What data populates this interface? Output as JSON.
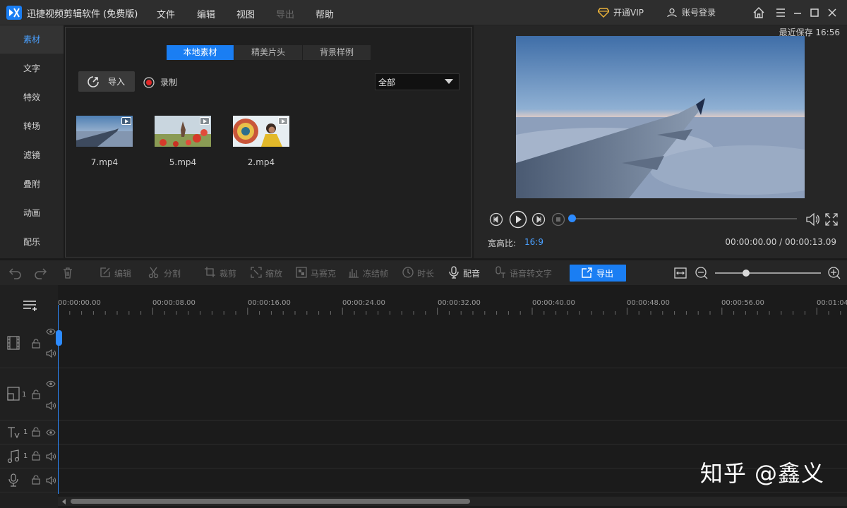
{
  "window": {
    "title": "迅捷视频剪辑软件 (免费版)",
    "menu": [
      "文件",
      "编辑",
      "视图",
      "导出",
      "帮助"
    ],
    "vip_label": "开通VIP",
    "login_label": "账号登录"
  },
  "nav": {
    "items": [
      "素材",
      "文字",
      "特效",
      "转场",
      "滤镜",
      "叠附",
      "动画",
      "配乐"
    ],
    "active_index": 0
  },
  "media": {
    "tabs": [
      "本地素材",
      "精美片头",
      "背景样例"
    ],
    "active_tab": 0,
    "import_label": "导入",
    "record_label": "录制",
    "filter_value": "全部",
    "files": [
      "7.mp4",
      "5.mp4",
      "2.mp4"
    ]
  },
  "preview": {
    "last_saved": "最近保存 16:56",
    "aspect_label": "宽高比:",
    "aspect_value": "16:9",
    "timecode": "00:00:00.00 / 00:00:13.09",
    "progress": 0
  },
  "toolbar": {
    "edit": "编辑",
    "split": "分割",
    "crop": "裁剪",
    "zoom": "缩放",
    "mosaic": "马赛克",
    "freeze": "冻结帧",
    "duration": "时长",
    "voiceover": "配音",
    "speech_to_text": "语音转文字",
    "export": "导出"
  },
  "timeline": {
    "ticks": [
      "00:00:00.00",
      "00:00:08.00",
      "00:00:16.00",
      "00:00:24.00",
      "00:00:32.00",
      "00:00:40.00",
      "00:00:48.00",
      "00:00:56.00",
      "00:01:04"
    ],
    "track_numbers": [
      "1",
      "1",
      "1"
    ]
  },
  "watermark": "知乎 @鑫义",
  "colors": {
    "accent": "#1a7ef3",
    "background": "#1b1b1b"
  }
}
